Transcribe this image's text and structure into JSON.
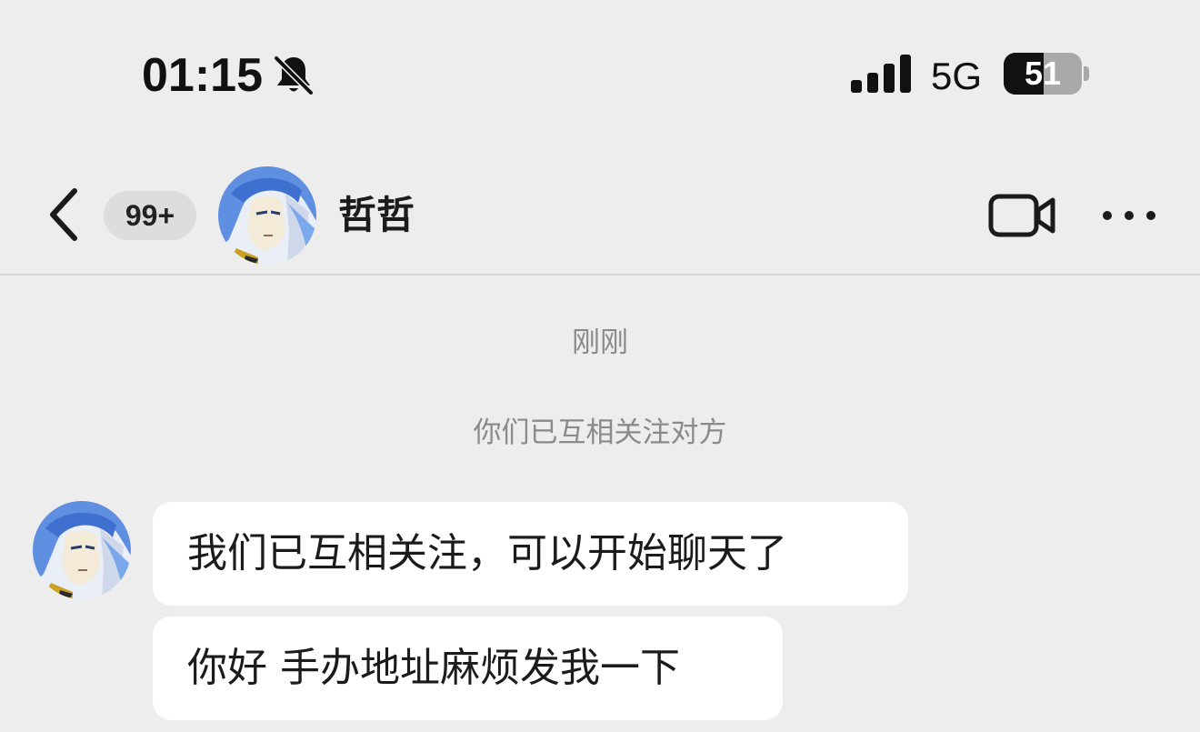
{
  "status_bar": {
    "time": "01:15",
    "network": "5G",
    "battery_percent": "51",
    "battery_level": 0.51,
    "icons": [
      "bell-muted-icon",
      "cellular-signal-icon",
      "battery-icon"
    ]
  },
  "nav": {
    "unread_count": "99+",
    "contact_name": "哲哲",
    "icons": [
      "back-chevron-icon",
      "avatar",
      "video-call-icon",
      "more-dots-icon"
    ]
  },
  "conversation": {
    "timestamp": "刚刚",
    "system_notice": "你们已互相关注对方",
    "messages": [
      {
        "sender": "哲哲",
        "text": "我们已互相关注，可以开始聊天了"
      },
      {
        "sender": "哲哲",
        "text": "你好 手办地址麻烦发我一下"
      }
    ]
  },
  "colors": {
    "background": "#ededed",
    "bubble": "#ffffff",
    "muted_text": "#8a8a8a",
    "primary_text": "#1b1b1b",
    "badge_bg": "#dddddd"
  }
}
